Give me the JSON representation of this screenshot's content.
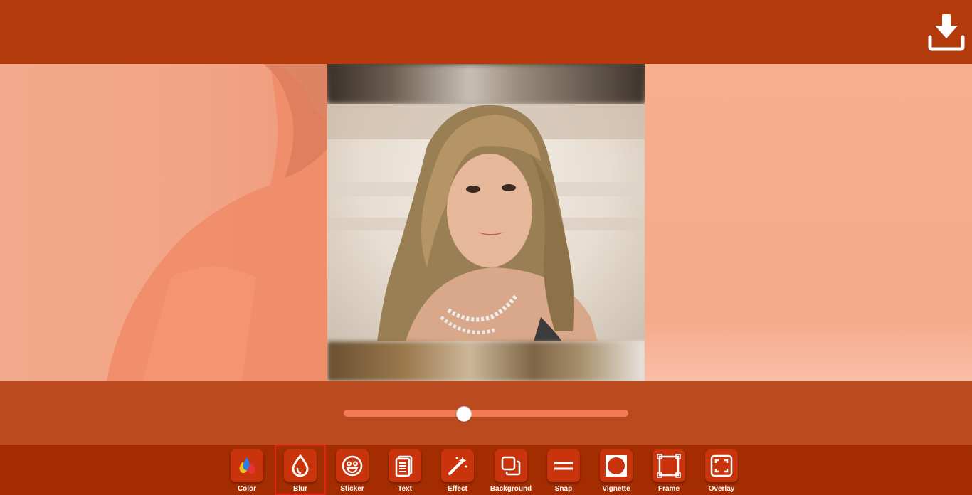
{
  "header": {
    "download_icon": "download-icon"
  },
  "blur_slider": {
    "value_fraction": 0.42
  },
  "toolbar": {
    "selected": "Blur",
    "tools": [
      {
        "label": "Color",
        "icon": "color-drops-icon"
      },
      {
        "label": "Blur",
        "icon": "blur-drop-icon"
      },
      {
        "label": "Sticker",
        "icon": "smiley-icon"
      },
      {
        "label": "Text",
        "icon": "text-document-icon"
      },
      {
        "label": "Effect",
        "icon": "magic-wand-icon"
      },
      {
        "label": "Background",
        "icon": "layers-icon"
      },
      {
        "label": "Snap",
        "icon": "equals-icon"
      },
      {
        "label": "Vignette",
        "icon": "vignette-icon"
      },
      {
        "label": "Frame",
        "icon": "frame-icon"
      },
      {
        "label": "Overlay",
        "icon": "overlay-icon"
      }
    ]
  },
  "colors": {
    "header_bg": "#b33b0b",
    "canvas_bg": "#f5ab8c",
    "slider_area_bg": "#bb4b1f",
    "slider_track": "#f47a55",
    "toolbar_bg": "#a32d00",
    "tool_button": "#c9340c",
    "selection_outline": "#e0221b"
  }
}
